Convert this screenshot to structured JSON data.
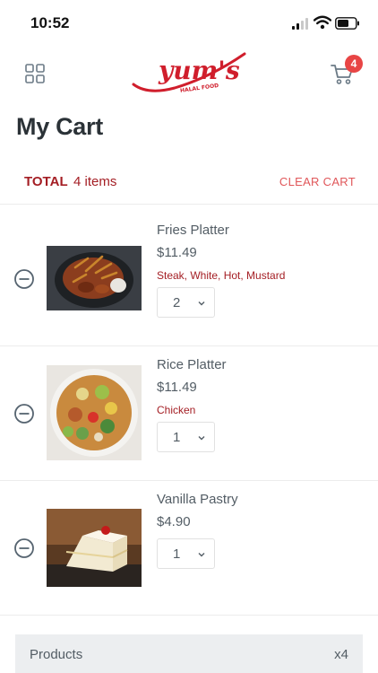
{
  "status_bar": {
    "time": "10:52"
  },
  "header": {
    "logo_text": "yum's",
    "logo_tagline": "HALAL FOOD",
    "cart_count": "4",
    "brand_color": "#d01e2c"
  },
  "page": {
    "title": "My Cart"
  },
  "summary_row": {
    "total_label": "TOTAL",
    "item_count": "4 items",
    "clear_label": "CLEAR CART"
  },
  "cart_items": [
    {
      "name": "Fries Platter",
      "price": "$11.49",
      "options": "Steak, White, Hot, Mustard",
      "quantity": "2",
      "image": "fries-platter-photo"
    },
    {
      "name": "Rice Platter",
      "price": "$11.49",
      "options": "Chicken",
      "quantity": "1",
      "image": "rice-platter-photo"
    },
    {
      "name": "Vanilla Pastry",
      "price": "$4.90",
      "options": "",
      "quantity": "1",
      "image": "vanilla-pastry-photo"
    }
  ],
  "order_summary": {
    "products_label": "Products",
    "products_value": "x4"
  },
  "icons": {
    "menu": "grid-icon",
    "cart": "cart-icon",
    "remove": "minus-circle-icon",
    "dropdown": "chevron-down-icon"
  },
  "colors": {
    "accent": "#a41e24",
    "badge": "#e84545",
    "clear": "#e0575a",
    "text": "#535d65"
  }
}
